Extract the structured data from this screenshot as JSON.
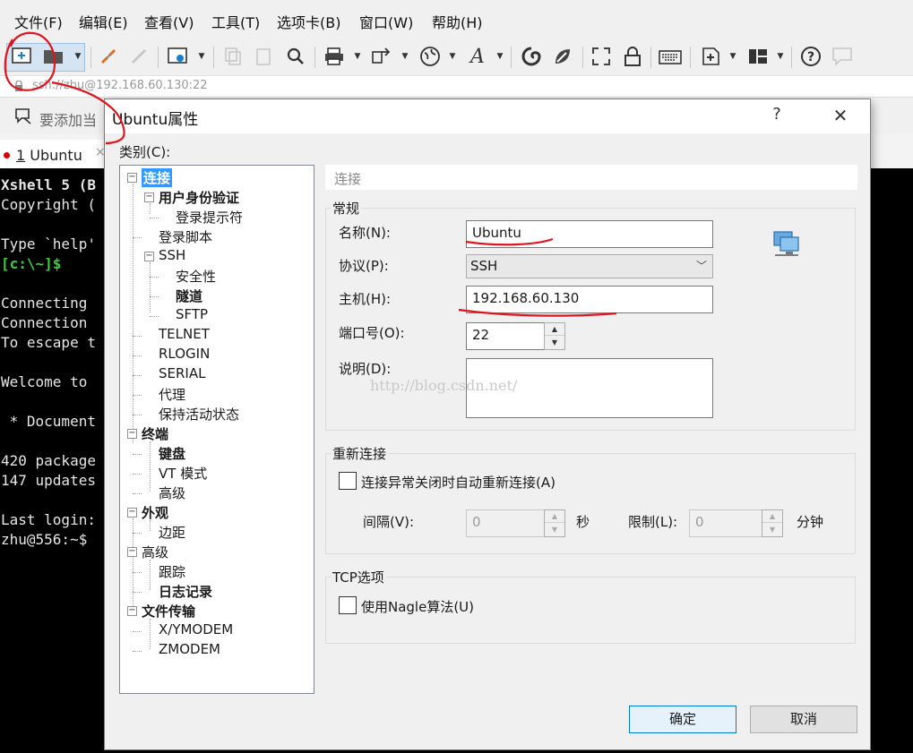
{
  "menu": [
    "文件(F)",
    "编辑(E)",
    "查看(V)",
    "工具(T)",
    "选项卡(B)",
    "窗口(W)",
    "帮助(H)"
  ],
  "toolbar": {
    "icons": [
      "new-session-icon",
      "open-folder-icon",
      "reconnect-icon",
      "disconnect-icon",
      "properties-icon",
      "copy-icon",
      "paste-icon",
      "find-icon",
      "print-icon",
      "transfer-icon",
      "globe-icon",
      "font-icon",
      "xftp-icon",
      "xmanager-icon",
      "fullscreen-icon",
      "lock-icon",
      "keyboard-icon",
      "add-tab-icon",
      "layout-icon",
      "help-icon",
      "chat-icon"
    ]
  },
  "address": "ssh://zhu@192.168.60.130:22",
  "quickbar": {
    "text": "要添加当"
  },
  "tab": {
    "number": "1",
    "label": "Ubuntu"
  },
  "terminal": {
    "lines": [
      {
        "text": "Xshell 5 (B",
        "bold": true
      },
      {
        "text": "Copyright ("
      },
      {
        "text": ""
      },
      {
        "text": "Type `help'"
      },
      {
        "text": "[c:\\~]$",
        "green": true
      },
      {
        "text": ""
      },
      {
        "text": "Connecting"
      },
      {
        "text": "Connection"
      },
      {
        "text": "To escape t"
      },
      {
        "text": ""
      },
      {
        "text": "Welcome to"
      },
      {
        "text": ""
      },
      {
        "text": " * Document"
      },
      {
        "text": ""
      },
      {
        "text": "420 package"
      },
      {
        "text": "147 updates"
      },
      {
        "text": ""
      },
      {
        "text": "Last login:"
      },
      {
        "text": "zhu@556:~$"
      }
    ]
  },
  "dialog": {
    "title": "Ubuntu属性",
    "help": "?",
    "close": "✕",
    "category_label": "类别(C):",
    "tree": [
      {
        "id": "conn",
        "label": "连接",
        "bold": true,
        "selected": true,
        "expander": "−"
      },
      {
        "id": "userauth",
        "label": "用户身份验证",
        "bold": true,
        "expander": "−"
      },
      {
        "id": "loginprompt",
        "label": "登录提示符"
      },
      {
        "id": "loginscript",
        "label": "登录脚本"
      },
      {
        "id": "ssh",
        "label": "SSH",
        "expander": "−"
      },
      {
        "id": "security",
        "label": "安全性"
      },
      {
        "id": "tunnel",
        "label": "隧道",
        "bold": true
      },
      {
        "id": "sftp",
        "label": "SFTP"
      },
      {
        "id": "telnet",
        "label": "TELNET"
      },
      {
        "id": "rlogin",
        "label": "RLOGIN"
      },
      {
        "id": "serial",
        "label": "SERIAL"
      },
      {
        "id": "proxy",
        "label": "代理"
      },
      {
        "id": "keepalive",
        "label": "保持活动状态"
      },
      {
        "id": "terminal",
        "label": "终端",
        "bold": true,
        "expander": "−"
      },
      {
        "id": "keyboard",
        "label": "键盘",
        "bold": true
      },
      {
        "id": "vtmode",
        "label": "VT 模式"
      },
      {
        "id": "advanced1",
        "label": "高级"
      },
      {
        "id": "appearance",
        "label": "外观",
        "bold": true,
        "expander": "−"
      },
      {
        "id": "margin",
        "label": "边距"
      },
      {
        "id": "advanced2",
        "label": "高级",
        "expander": "−"
      },
      {
        "id": "trace",
        "label": "跟踪"
      },
      {
        "id": "logging",
        "label": "日志记录",
        "bold": true
      },
      {
        "id": "filetransfer",
        "label": "文件传输",
        "bold": true,
        "expander": "−"
      },
      {
        "id": "xymodem",
        "label": "X/YMODEM"
      },
      {
        "id": "zmodem",
        "label": "ZMODEM"
      }
    ],
    "section_header": "连接",
    "general": {
      "title": "常规",
      "name_label": "名称(N):",
      "name_value": "Ubuntu",
      "protocol_label": "协议(P):",
      "protocol_value": "SSH",
      "host_label": "主机(H):",
      "host_value": "192.168.60.130",
      "port_label": "端口号(O):",
      "port_value": "22",
      "desc_label": "说明(D):",
      "watermark": "http://blog.csdn.net/"
    },
    "reconnect": {
      "title": "重新连接",
      "auto_label": "连接异常关闭时自动重新连接(A)",
      "interval_label": "间隔(V):",
      "interval_value": "0",
      "interval_unit": "秒",
      "limit_label": "限制(L):",
      "limit_value": "0",
      "limit_unit": "分钟"
    },
    "tcp": {
      "title": "TCP选项",
      "nagle_label": "使用Nagle算法(U)"
    },
    "ok": "确定",
    "cancel": "取消"
  },
  "colors": {
    "selection": "#3399ff",
    "annotation": "#e0141e",
    "terminal_bg": "#000000",
    "prompt_green": "#3ccf3c"
  }
}
